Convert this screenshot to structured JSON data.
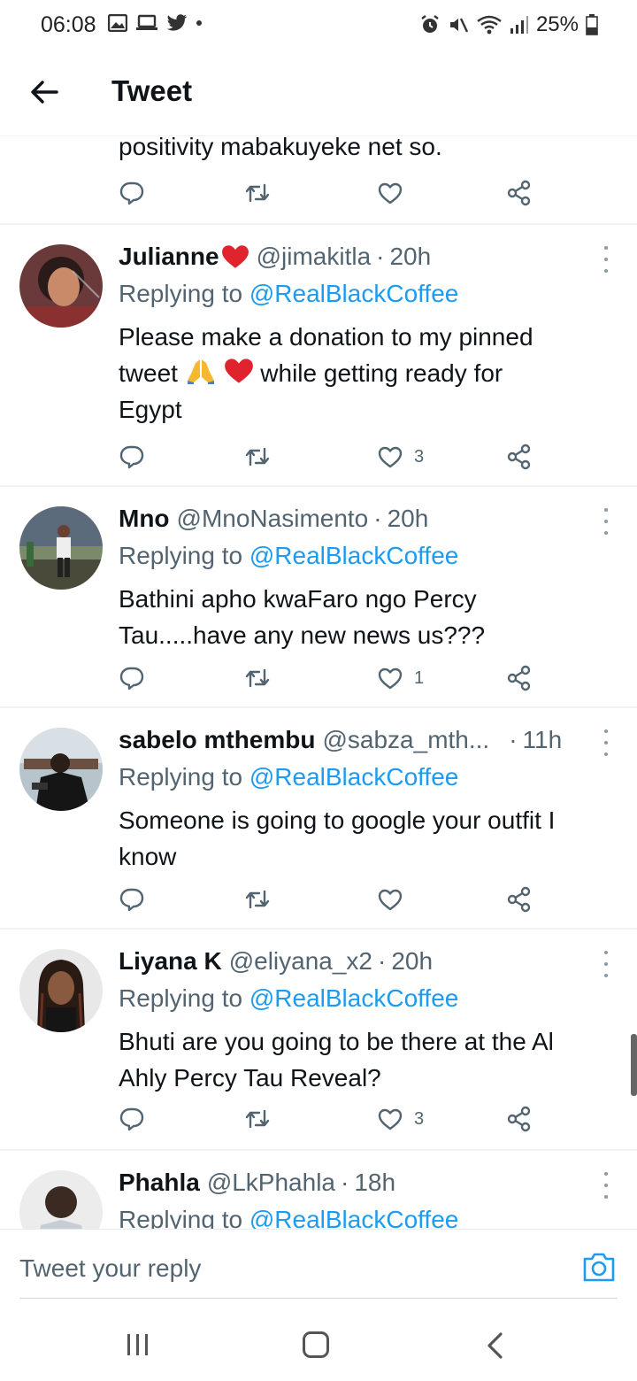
{
  "status_bar": {
    "time": "06:08",
    "battery": "25%"
  },
  "header": {
    "title": "Tweet"
  },
  "partial_tweet": {
    "text": "positivity mabakuyeke net so."
  },
  "tweets": [
    {
      "name": "Julianne",
      "handle": "@jimakitla",
      "separator": "·",
      "time": "20h",
      "replying_prefix": "Replying to ",
      "replying_to": "@RealBlackCoffee",
      "body_line1": "Please make a donation to my pinned",
      "body_line2_before": "tweet",
      "body_line2_after": "while getting ready for",
      "body_line3": "Egypt",
      "like_count": "3"
    },
    {
      "name": "Mno",
      "handle": "@MnoNasimento",
      "separator": "·",
      "time": "20h",
      "replying_prefix": "Replying to ",
      "replying_to": "@RealBlackCoffee",
      "body_line1": "Bathini apho kwaFaro ngo Percy",
      "body_line2": "Tau.....have any new news us???",
      "like_count": "1"
    },
    {
      "name": "sabelo mthembu",
      "handle": "@sabza_mth...",
      "separator": "·",
      "time": "11h",
      "replying_prefix": "Replying to ",
      "replying_to": "@RealBlackCoffee",
      "body_line1": "Someone is going to google your outfit I",
      "body_line2": "know",
      "like_count": ""
    },
    {
      "name": "Liyana K",
      "handle": "@eliyana_x2",
      "separator": "·",
      "time": "20h",
      "replying_prefix": "Replying to ",
      "replying_to": "@RealBlackCoffee",
      "body_line1": "Bhuti are you going to be there at the Al",
      "body_line2": "Ahly Percy Tau Reveal?",
      "like_count": "3"
    },
    {
      "name": "Phahla",
      "handle": "@LkPhahla",
      "separator": "·",
      "time": "18h",
      "replying_prefix": "Replying to ",
      "replying_to": "@RealBlackCoffee"
    }
  ],
  "composer": {
    "placeholder": "Tweet your reply"
  },
  "colors": {
    "link_blue": "#1d9bf0",
    "secondary_text": "#536471",
    "heart_red": "#e0245e"
  },
  "icons": {
    "reply": "reply-icon",
    "retweet": "retweet-icon",
    "like": "heart-icon",
    "share": "share-icon",
    "camera": "camera-icon",
    "back": "arrow-left-icon"
  }
}
